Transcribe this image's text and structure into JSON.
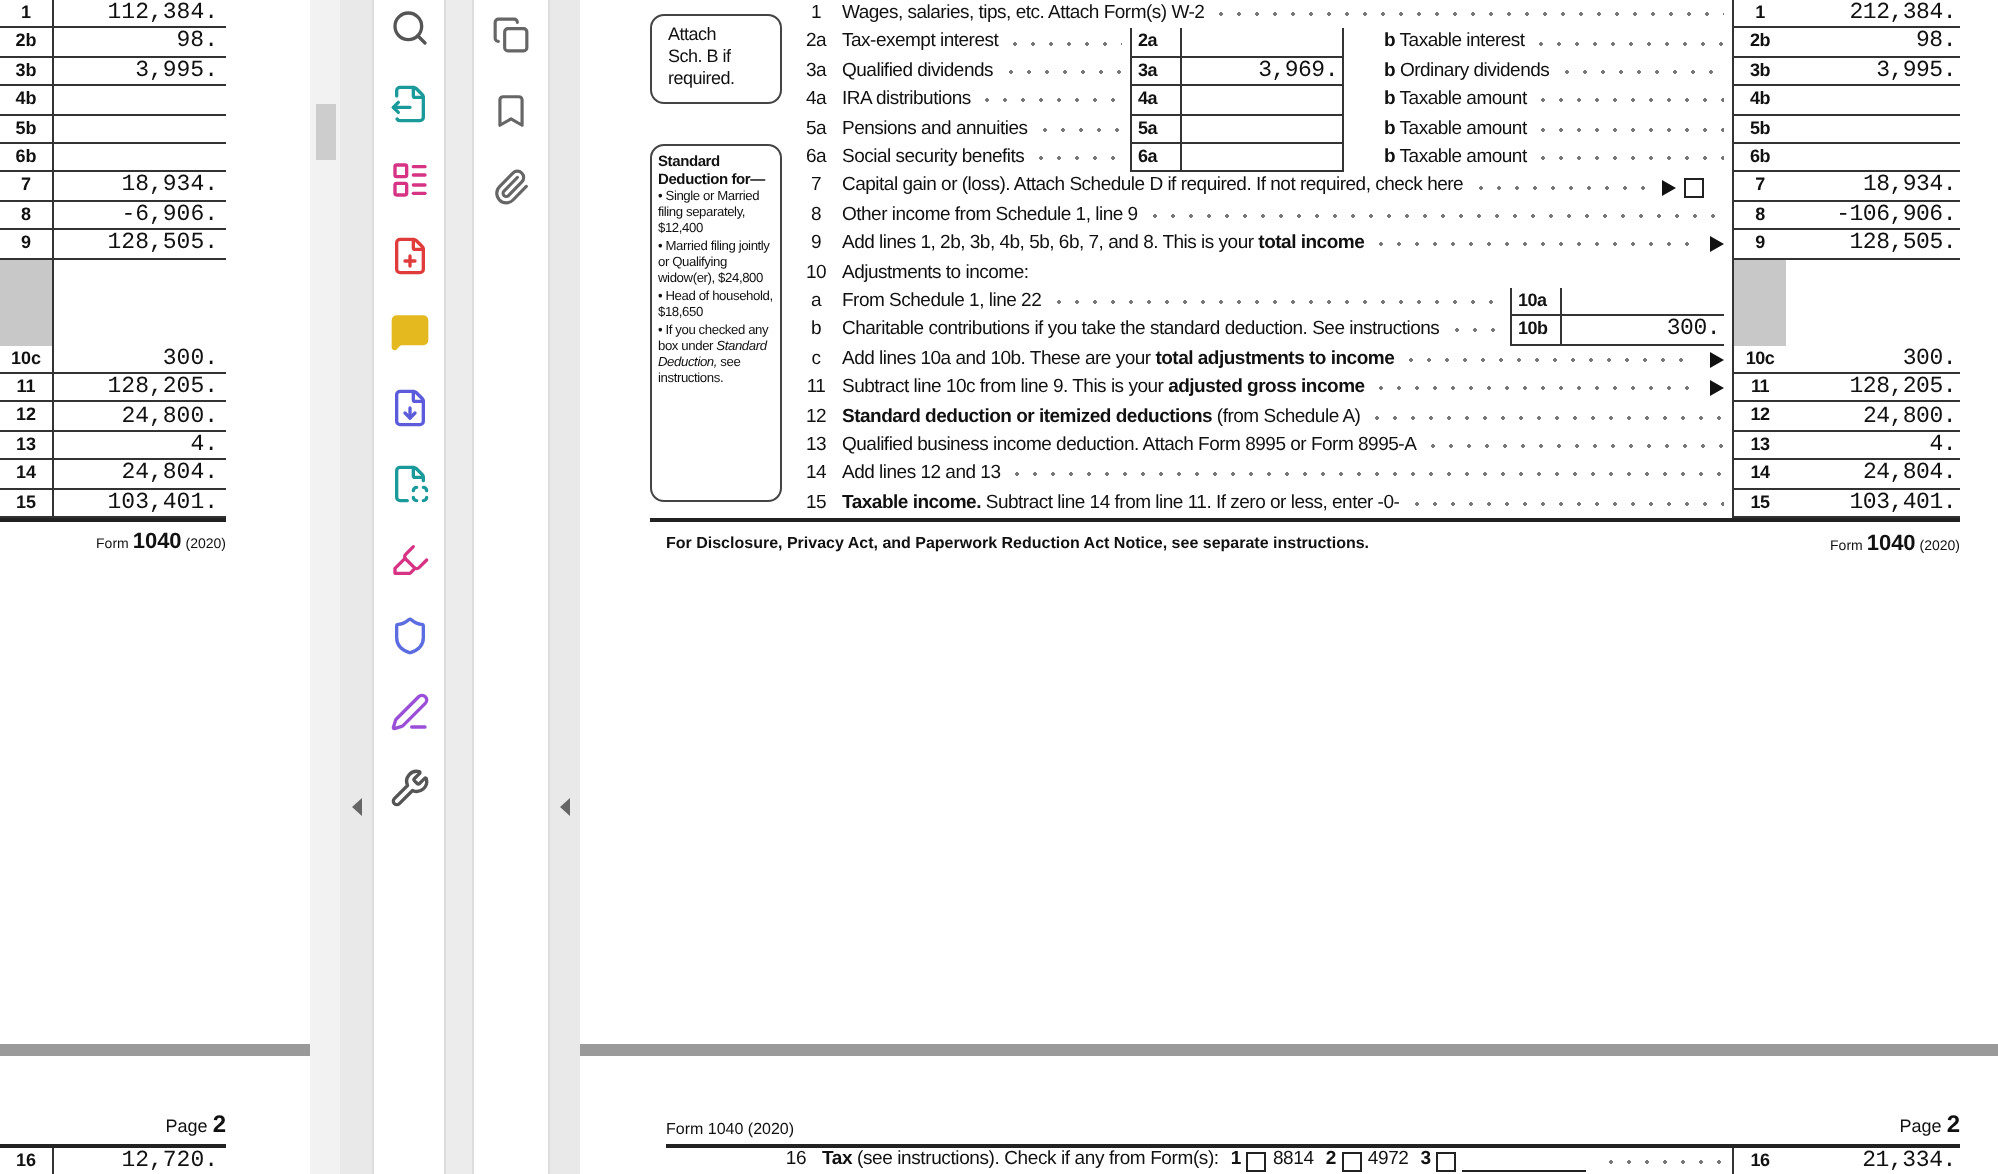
{
  "left_document": {
    "rows": [
      {
        "kind": "row",
        "line": "1",
        "amount": "112,384."
      },
      {
        "kind": "row",
        "line": "2b",
        "amount": "98."
      },
      {
        "kind": "row",
        "line": "3b",
        "amount": "3,995."
      },
      {
        "kind": "row",
        "line": "4b"
      },
      {
        "kind": "row",
        "line": "5b"
      },
      {
        "kind": "row",
        "line": "6b"
      },
      {
        "kind": "row",
        "line": "7",
        "amount": "18,934."
      },
      {
        "kind": "row",
        "line": "8",
        "amount": "-6,906."
      },
      {
        "kind": "row",
        "line": "9",
        "amount": "128,505."
      },
      {
        "kind": "shaded"
      },
      {
        "kind": "row",
        "line": "10c",
        "amount": "300."
      },
      {
        "kind": "row",
        "line": "11",
        "amount": "128,205."
      },
      {
        "kind": "row",
        "line": "12",
        "amount": "24,800."
      },
      {
        "kind": "row",
        "line": "13",
        "amount": "4."
      },
      {
        "kind": "row",
        "line": "14",
        "amount": "24,804."
      },
      {
        "kind": "row",
        "line": "15",
        "amount": "103,401."
      }
    ],
    "footer": {
      "prefix": "Form",
      "number": "1040",
      "year": "(2020)"
    },
    "next_page": {
      "page_label": "Page",
      "page_number": "2",
      "line": "16",
      "amount": "12,720."
    }
  },
  "form": {
    "attach_note": "Attach Sch. B if required.",
    "standard_deduction": {
      "title": "Standard Deduction for—",
      "items": [
        "• Single or Married filing separately, $12,400",
        "• Married filing jointly or Qualifying widow(er), $24,800",
        "• Head of household, $18,650",
        "• If you checked any box under *Standard Deduction,* see instructions."
      ]
    },
    "lines": [
      {
        "kind": "full",
        "line": "1",
        "label": "Wages, salaries, tips, etc. Attach Form(s) W-2",
        "right_line": "1",
        "amount": "212,384."
      },
      {
        "kind": "paired",
        "line": "2a",
        "label": "Tax-exempt interest",
        "mid_line": "2a",
        "b_letter": "b",
        "b_label": "Taxable interest",
        "right_line": "2b",
        "amount": "98."
      },
      {
        "kind": "paired",
        "line": "3a",
        "label": "Qualified dividends",
        "mid_line": "3a",
        "mid_amount": "3,969.",
        "b_letter": "b",
        "b_label": "Ordinary dividends",
        "right_line": "3b",
        "amount": "3,995."
      },
      {
        "kind": "paired",
        "line": "4a",
        "label": "IRA distributions",
        "mid_line": "4a",
        "b_letter": "b",
        "b_label": "Taxable amount",
        "right_line": "4b"
      },
      {
        "kind": "paired",
        "line": "5a",
        "label": "Pensions and annuities",
        "mid_line": "5a",
        "b_letter": "b",
        "b_label": "Taxable amount",
        "right_line": "5b"
      },
      {
        "kind": "paired",
        "line": "6a",
        "label": "Social security benefits",
        "mid_line": "6a",
        "b_letter": "b",
        "b_label": "Taxable amount",
        "right_line": "6b"
      },
      {
        "kind": "full",
        "line": "7",
        "label": "Capital gain or (loss). Attach Schedule D if required. If not required, check here",
        "arrow": true,
        "checkbox": {
          "checked": false
        },
        "right_line": "7",
        "amount": "18,934."
      },
      {
        "kind": "full",
        "line": "8",
        "label": "Other income from Schedule 1, line 9",
        "right_line": "8",
        "amount": "-106,906."
      },
      {
        "kind": "full",
        "line": "9",
        "label": "Add lines 1, 2b, 3b, 4b, 5b, 6b, 7, and 8. This is your **total income**",
        "arrow": true,
        "right_line": "9",
        "amount": "128,505."
      },
      {
        "kind": "heading",
        "line": "10",
        "label": "Adjustments to income:"
      },
      {
        "kind": "inner",
        "line": "a",
        "label": "From Schedule 1, line 22",
        "mid_line": "10a"
      },
      {
        "kind": "inner",
        "line": "b",
        "label": "Charitable contributions if you take the standard deduction. See instructions",
        "mid_line": "10b",
        "mid_amount": "300."
      },
      {
        "kind": "full",
        "line": "c",
        "label": "Add lines 10a and 10b. These are your **total adjustments to income**",
        "arrow": true,
        "right_line": "10c",
        "amount": "300."
      },
      {
        "kind": "full",
        "line": "11",
        "label": "Subtract line 10c from line 9. This is your **adjusted gross income**",
        "arrow": true,
        "right_line": "11",
        "amount": "128,205."
      },
      {
        "kind": "full",
        "line": "12",
        "label": "**Standard deduction or itemized deductions** (from Schedule A)",
        "right_line": "12",
        "amount": "24,800."
      },
      {
        "kind": "full",
        "line": "13",
        "label": "Qualified business income deduction. Attach Form 8995 or Form 8995-A",
        "right_line": "13",
        "amount": "4."
      },
      {
        "kind": "full",
        "line": "14",
        "label": "Add lines 12 and 13",
        "right_line": "14",
        "amount": "24,804."
      },
      {
        "kind": "full",
        "line": "15",
        "label": "**Taxable income.** Subtract line 14 from line 11. If zero or less, enter -0-",
        "right_line": "15",
        "amount": "103,401."
      }
    ],
    "notice": "For Disclosure, Privacy Act, and Paperwork Reduction Act Notice, see separate instructions.",
    "footer": {
      "prefix": "Form",
      "number": "1040",
      "year": "(2020)"
    }
  },
  "page_2": {
    "form_title": "Form 1040 (2020)",
    "page_label": "Page",
    "page_number": "2",
    "line_16": {
      "line": "16",
      "label": "**Tax** (see instructions). Check if any from Form(s):",
      "options": [
        {
          "kind": "form",
          "number": "1",
          "checked": false,
          "form": "8814"
        },
        {
          "kind": "form",
          "number": "2",
          "checked": false,
          "form": "4972"
        },
        {
          "kind": "blank",
          "number": "3",
          "checked": false
        }
      ],
      "right_line": "16",
      "amount": "21,334."
    }
  }
}
